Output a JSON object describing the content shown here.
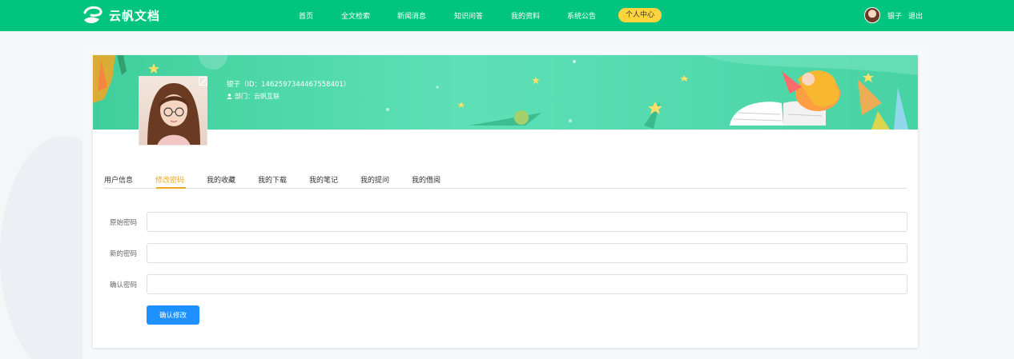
{
  "header": {
    "logo_text": "云帆文档",
    "nav": [
      {
        "label": "首页"
      },
      {
        "label": "全文检索"
      },
      {
        "label": "新闻消息"
      },
      {
        "label": "知识问答"
      },
      {
        "label": "我的资料"
      },
      {
        "label": "系统公告"
      },
      {
        "label": "个人中心",
        "active": true
      }
    ],
    "username": "银子",
    "logout_label": "退出"
  },
  "profile": {
    "name_line": "银子（ID：1462597344467558401）",
    "dept_line": "部门：云帆互联"
  },
  "tabs": [
    {
      "label": "用户信息"
    },
    {
      "label": "修改密码",
      "active": true
    },
    {
      "label": "我的收藏"
    },
    {
      "label": "我的下载"
    },
    {
      "label": "我的笔记"
    },
    {
      "label": "我的提问"
    },
    {
      "label": "我的借阅"
    }
  ],
  "form": {
    "fields": [
      {
        "label": "原始密码",
        "value": "",
        "placeholder": ""
      },
      {
        "label": "新的密码",
        "value": "",
        "placeholder": ""
      },
      {
        "label": "确认密码",
        "value": "",
        "placeholder": ""
      }
    ],
    "submit_label": "确认修改"
  },
  "colors": {
    "header_bg": "#00c47f",
    "active_nav_bg": "#ffd33d",
    "active_tab": "#f0a81e",
    "primary_button": "#1e90ff"
  }
}
